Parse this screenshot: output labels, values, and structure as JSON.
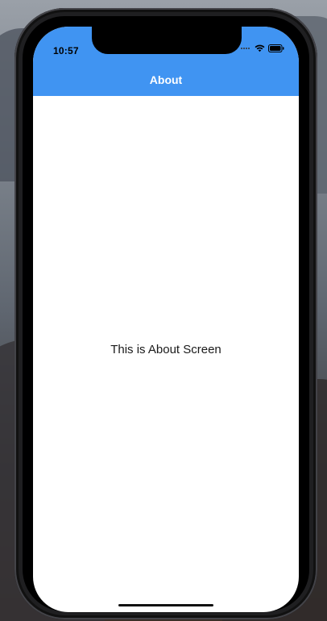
{
  "status_bar": {
    "time": "10:57"
  },
  "nav_bar": {
    "title": "About"
  },
  "main": {
    "text": "This is About Screen"
  },
  "colors": {
    "accent": "#4094f2",
    "screen_background": "#ffffff",
    "text": "#1a1a1a"
  },
  "icons": {
    "wifi": "wifi-icon",
    "battery": "battery-icon",
    "signal": "signal-icon"
  }
}
